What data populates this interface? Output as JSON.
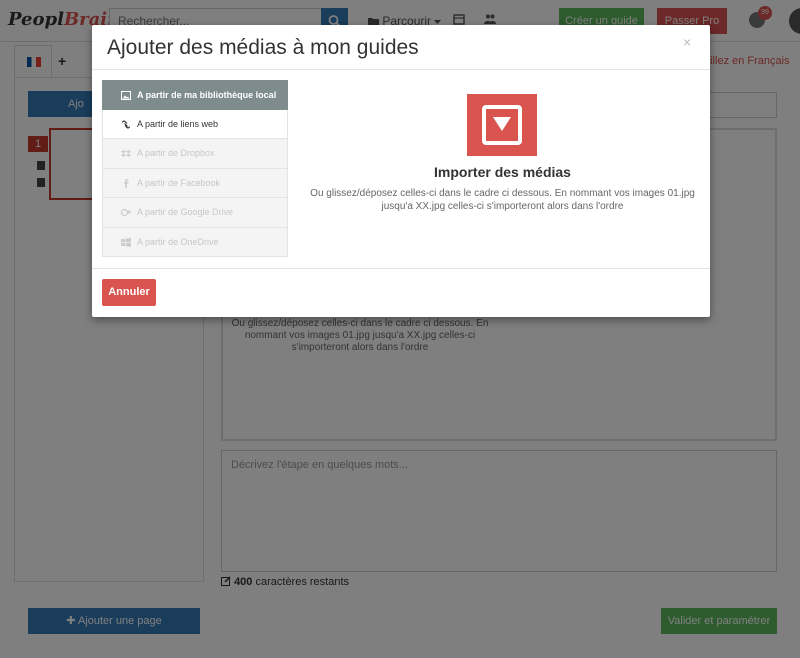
{
  "navbar": {
    "logo_main": "Peopl",
    "logo_accent": "Brain",
    "search_placeholder": "Rechercher...",
    "parcourir_label": "Parcourir",
    "create_guide_label": "Créer un guide",
    "pro_label": "Passer Pro",
    "notification_count": "99"
  },
  "page": {
    "lang_notice": "aillez en Français",
    "add_button_partial": "Ajo",
    "page_number": "1",
    "drop_text": "Ou glissez/déposez celles-ci dans le cadre ci dessous. En nommant vos images 01.jpg jusqu'a XX.jpg celles-ci s'importeront alors dans l'ordre",
    "description_placeholder": "Décrivez l'étape en quelques mots...",
    "chars_remaining_count": "400",
    "chars_remaining_label": "caractères restants",
    "add_page_label": "Ajouter une page",
    "validate_label": "Valider et paramétrer"
  },
  "modal": {
    "title": "Ajouter des médias à mon guides",
    "close_symbol": "×",
    "sources": [
      {
        "label": "A partir de ma bibliothèque local",
        "icon": "image-icon",
        "state": "active"
      },
      {
        "label": "A partir de liens web",
        "icon": "link-icon",
        "state": "enabled"
      },
      {
        "label": "A partir de Dropbox",
        "icon": "dropbox-icon",
        "state": "disabled"
      },
      {
        "label": "A partir de Facebook",
        "icon": "facebook-icon",
        "state": "disabled"
      },
      {
        "label": "A partir de Google Drive",
        "icon": "google-plus-icon",
        "state": "disabled"
      },
      {
        "label": "A partir de OneDrive",
        "icon": "windows-icon",
        "state": "disabled"
      }
    ],
    "import_title": "Importer des médias",
    "import_desc": "Ou glissez/déposez celles-ci dans le cadre ci dessous. En nommant vos images 01.jpg jusqu'a XX.jpg celles-ci s'importeront alors dans l'ordre",
    "cancel_label": "Annuler"
  },
  "colors": {
    "primary": "#337ab7",
    "danger": "#d9534f",
    "success": "#5cb85c",
    "active_source": "#7f8c8d"
  }
}
